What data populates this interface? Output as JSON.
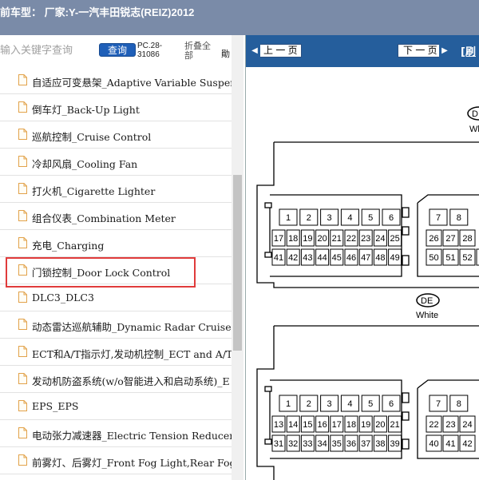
{
  "window": {
    "title": "前车型： 厂家:Y-一汽丰田锐志(REIZ)2012"
  },
  "search": {
    "placeholder": "输入关键字查询",
    "button_label": "查询",
    "code": "PC.28-31086",
    "collapse_label": "折叠全部",
    "cut_text": "勛"
  },
  "tree_items": [
    "自适应可变悬架_Adaptive Variable Suspension",
    "倒车灯_Back-Up Light",
    "巡航控制_Cruise Control",
    "冷却风扇_Cooling Fan",
    "打火机_Cigarette Lighter",
    "组合仪表_Combination Meter",
    "充电_Charging",
    "门锁控制_Door Lock Control",
    "DLC3_DLC3",
    "动态雷达巡航辅助_Dynamic Radar Cruise Co",
    "ECT和A/T指示灯,发动机控制_ECT and A/T I",
    "发动机防盗系统(w/o智能进入和启动系统)_E",
    "EPS_EPS",
    "电动张力减速器_Electric Tension Reducer",
    "前雾灯、后雾灯_Front Fog Light,Rear Fog Li"
  ],
  "selected_index": 7,
  "viewer": {
    "prev_label": "上 一 页",
    "next_label": "下 一 页",
    "refresh_label": "[刷",
    "connector1": {
      "code": "D",
      "color": "Wh"
    },
    "connector2": {
      "code": "DE",
      "color": "White"
    },
    "c1_rows": [
      [
        "1",
        "2",
        "3",
        "4",
        "5",
        "6"
      ],
      [
        "17",
        "18",
        "19",
        "20",
        "21",
        "22",
        "23",
        "24",
        "25"
      ],
      [
        "41",
        "42",
        "43",
        "44",
        "45",
        "46",
        "47",
        "48",
        "49"
      ]
    ],
    "c1_right_rows": [
      [
        "7",
        "8"
      ],
      [
        "26",
        "27",
        "28"
      ],
      [
        "50",
        "51",
        "52",
        "53"
      ]
    ],
    "c2_rows": [
      [
        "1",
        "2",
        "3",
        "4",
        "5",
        "6"
      ],
      [
        "13",
        "14",
        "15",
        "16",
        "17",
        "18",
        "19",
        "20",
        "21"
      ],
      [
        "31",
        "32",
        "33",
        "34",
        "35",
        "36",
        "37",
        "38",
        "39"
      ]
    ],
    "c2_right_rows": [
      [
        "7",
        "8"
      ],
      [
        "22",
        "23",
        "24"
      ],
      [
        "40",
        "41",
        "42"
      ]
    ]
  },
  "colors": {
    "titlebar": "#7a8ba8",
    "nav": "#255e9c",
    "search_button": "#1f5fb8",
    "highlight": "#e03b3b"
  }
}
